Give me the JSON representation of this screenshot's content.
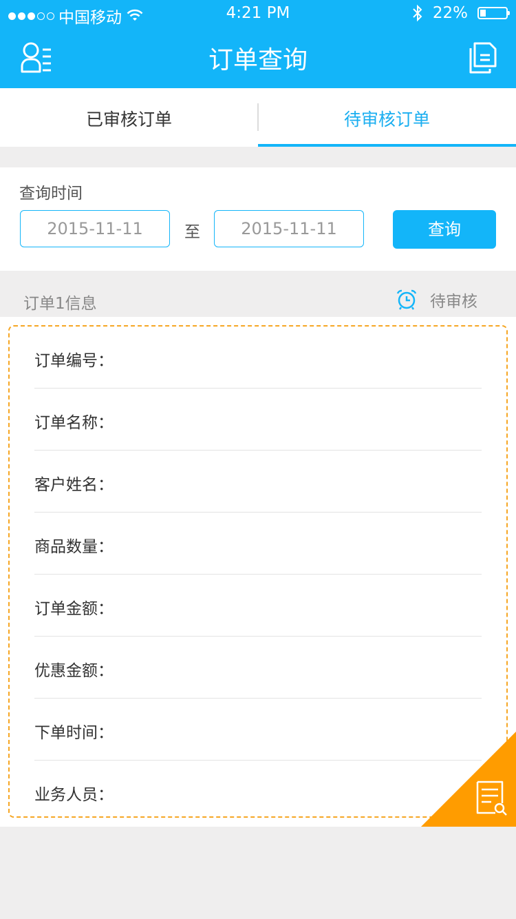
{
  "status_bar": {
    "carrier": "中国移动",
    "time": "4:21 PM",
    "battery_percent": "22%",
    "battery_level": 0.22,
    "signal_bars_filled": 3,
    "signal_bars_total": 5
  },
  "nav": {
    "title": "订单查询",
    "left_icon": "user-list-icon",
    "right_icon": "documents-icon"
  },
  "tabs": [
    {
      "label": "已审核订单",
      "active": false
    },
    {
      "label": "待审核订单",
      "active": true
    }
  ],
  "query": {
    "label": "查询时间",
    "start_date": "2015-11-11",
    "separator": "至",
    "end_date": "2015-11-11",
    "button": "查询"
  },
  "order": {
    "title": "订单1信息",
    "status": "待审核",
    "fields": [
      {
        "label": "订单编号："
      },
      {
        "label": "订单名称："
      },
      {
        "label": "客户姓名："
      },
      {
        "label": "商品数量："
      },
      {
        "label": "订单金额："
      },
      {
        "label": "优惠金额："
      },
      {
        "label": "下单时间："
      },
      {
        "label": "业务人员："
      }
    ]
  },
  "colors": {
    "primary": "#13b5f9",
    "accent_orange": "#ff9c00",
    "background": "#efeeee"
  }
}
